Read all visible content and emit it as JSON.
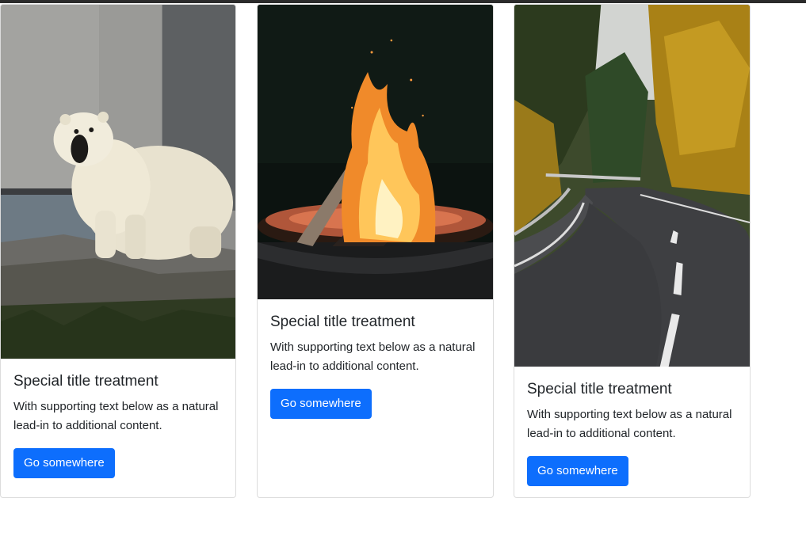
{
  "colors": {
    "primary": "#0d6efd",
    "card_border": "#dcdcdc",
    "text": "#212529"
  },
  "cards": [
    {
      "image": "polar-bear-photo",
      "title": "Special title treatment",
      "text": "With supporting text below as a natural lead-in to additional content.",
      "button_label": "Go somewhere"
    },
    {
      "image": "campfire-photo",
      "title": "Special title treatment",
      "text": "With supporting text below as a natural lead-in to additional content.",
      "button_label": "Go somewhere"
    },
    {
      "image": "forest-road-photo",
      "title": "Special title treatment",
      "text": "With supporting text below as a natural lead-in to additional content.",
      "button_label": "Go somewhere"
    }
  ]
}
